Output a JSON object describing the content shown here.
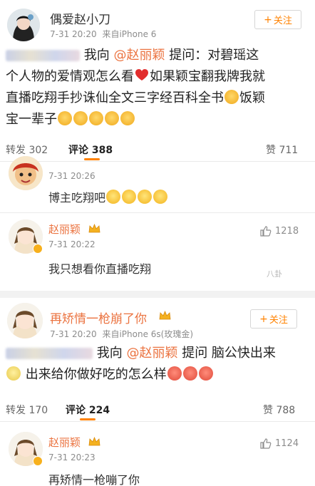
{
  "post1": {
    "username": "偶爱赵小刀",
    "time": "7-31 20:20",
    "source": "来自iPhone 6",
    "follow": "关注",
    "line1_a": "我向",
    "line1_mention": "@赵丽颖",
    "line1_b": "提问：对碧瑶这",
    "line2": "个人物的爱情观怎么看",
    "line2_b": "如果颖宝翻我牌我就",
    "line3": "直播吃翔手抄诛仙全文三字经百科全书",
    "line3_b": "饭颖",
    "line4": "宝一辈子",
    "actions": {
      "repost": "转发 302",
      "comment": "评论 388",
      "like": "赞 711"
    }
  },
  "comment1": {
    "time": "7-31 20:26",
    "text": "博主吃翔吧"
  },
  "comment2": {
    "username": "赵丽颖",
    "time": "7-31 20:22",
    "text": "我只想看你直播吃翔",
    "likes": "1218"
  },
  "watermark": "八卦",
  "post2": {
    "username": "再矫情一枪崩了你",
    "time": "7-31 20:20",
    "source": "来自iPhone 6s(玫瑰金)",
    "follow": "关注",
    "line1_a": "我向",
    "line1_mention": "@赵丽颖",
    "line1_b": "提问  脑公快出来",
    "line2": "出来给你做好吃的怎么样",
    "actions": {
      "repost": "转发 170",
      "comment": "评论 224",
      "like": "赞 788"
    }
  },
  "comment3": {
    "username": "赵丽颖",
    "time": "7-31 20:23",
    "text": "再矫情一枪嘣了你",
    "likes": "1124"
  },
  "colors": {
    "accent": "#ff8200",
    "mention": "#eb7340",
    "text": "#222222",
    "meta": "#8c8c8c"
  }
}
